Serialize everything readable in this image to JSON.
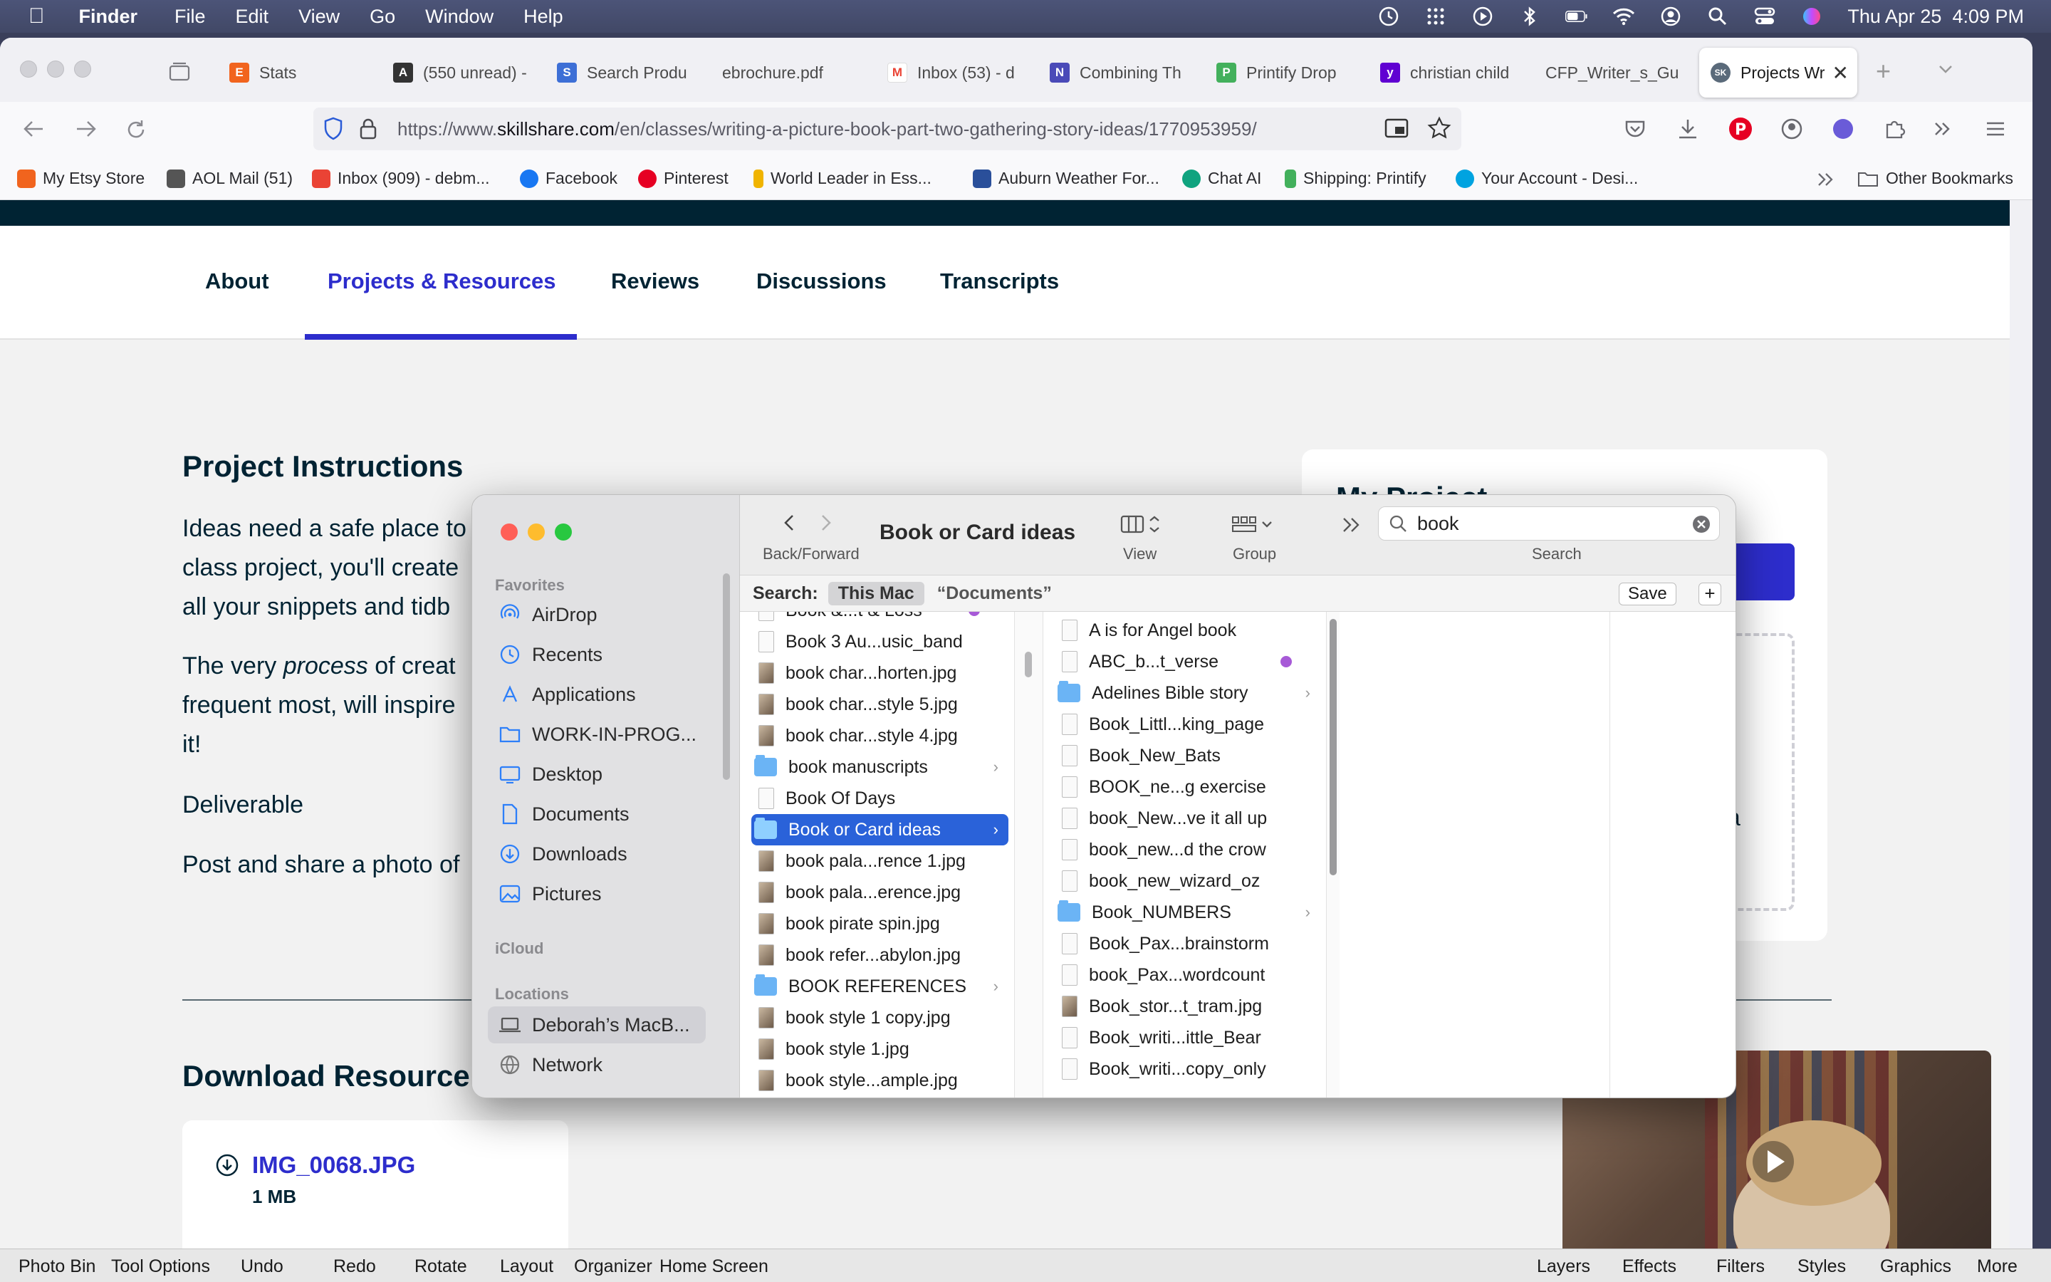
{
  "menubar": {
    "app": "Finder",
    "items": [
      "File",
      "Edit",
      "View",
      "Go",
      "Window",
      "Help"
    ],
    "datetime": "Thu Apr 25  4:09 PM"
  },
  "browser": {
    "tabs": [
      {
        "label": "Stats",
        "icon": "etsy-icon",
        "color": "#f1641e"
      },
      {
        "label": "(550 unread) -",
        "icon": "aol-icon",
        "color": "#333333"
      },
      {
        "label": "Search Produ",
        "icon": "search-product-icon",
        "color": "#3d6fd6"
      },
      {
        "label": "ebrochure.pdf",
        "icon": "",
        "color": ""
      },
      {
        "label": "Inbox (53) - d",
        "icon": "gmail-icon",
        "color": "#ea4335"
      },
      {
        "label": "Combining Th",
        "icon": "notion-icon",
        "color": "#4a4ab8"
      },
      {
        "label": "Printify Drop",
        "icon": "printify-icon",
        "color": "#43b05c"
      },
      {
        "label": "christian child",
        "icon": "yahoo-icon",
        "color": "#6001d2"
      },
      {
        "label": "CFP_Writer_s_Gu",
        "icon": "",
        "color": ""
      },
      {
        "label": "Projects Wr",
        "icon": "skillshare-icon",
        "color": "#5a6a7a"
      }
    ],
    "url_prefix": "https://www.",
    "url_domain": "skillshare.com",
    "url_rest": "/en/classes/writing-a-picture-book-part-two-gathering-story-ideas/1770953959/",
    "bookmarks": [
      {
        "label": "My Etsy Store",
        "color": "#f1641e"
      },
      {
        "label": "AOL Mail (51)",
        "color": "#555555"
      },
      {
        "label": "Inbox (909) - debm...",
        "color": "#ea4335"
      },
      {
        "label": "Facebook",
        "color": "#1877f2"
      },
      {
        "label": "Pinterest",
        "color": "#e60023"
      },
      {
        "label": "World Leader in Ess...",
        "color": "#f0b400"
      },
      {
        "label": "Auburn Weather For...",
        "color": "#2a4f9a"
      },
      {
        "label": "Chat AI",
        "color": "#10a37f"
      },
      {
        "label": "Shipping: Printify",
        "color": "#43b05c"
      },
      {
        "label": "Your Account - Desi...",
        "color": "#00a3e0"
      }
    ],
    "other_bookmarks": "Other Bookmarks"
  },
  "page": {
    "tabs": [
      "About",
      "Projects & Resources",
      "Reviews",
      "Discussions",
      "Transcripts"
    ],
    "active_tab": "Projects & Resources",
    "instructions_title": "Project Instructions",
    "para1": [
      "Ideas need a safe place to rest while life keeps swirling and dancing around them! For your",
      "class project, you'll create",
      "all your snippets and tidb"
    ],
    "para2_a": "The very ",
    "para2_em": "process",
    "para2_b": " of creat",
    "para2_line2": "frequent most, will inspire",
    "para2_line3": "it!",
    "deliverable": "Deliverable",
    "post_share": "Post and share a photo of",
    "my_project": "My Project",
    "my_project_fragment": "t a",
    "download_title": "Download Resource",
    "resource_name": "IMG_0068.JPG",
    "resource_size": "1 MB"
  },
  "finder": {
    "title": "Book or Card ideas",
    "back_forward_label": "Back/Forward",
    "view_label": "View",
    "group_label": "Group",
    "search_label": "Search",
    "search_value": "book",
    "scope_label": "Search:",
    "scope_this_mac": "This Mac",
    "scope_documents": "“Documents”",
    "save_label": "Save",
    "sidebar_favorites": "Favorites",
    "sidebar_icloud": "iCloud",
    "sidebar_locations": "Locations",
    "favorites": [
      {
        "label": "AirDrop",
        "icon": "airdrop-icon"
      },
      {
        "label": "Recents",
        "icon": "recents-clock-icon"
      },
      {
        "label": "Applications",
        "icon": "applications-icon"
      },
      {
        "label": "WORK-IN-PROG...",
        "icon": "folder-icon"
      },
      {
        "label": "Desktop",
        "icon": "desktop-icon"
      },
      {
        "label": "Documents",
        "icon": "document-icon"
      },
      {
        "label": "Downloads",
        "icon": "download-icon"
      },
      {
        "label": "Pictures",
        "icon": "pictures-icon"
      }
    ],
    "locations": [
      {
        "label": "Deborah’s MacB...",
        "icon": "laptop-icon"
      },
      {
        "label": "Network",
        "icon": "network-globe-icon"
      }
    ],
    "col1": [
      {
        "name": "Book &...t & Loss",
        "kind": "file",
        "tag": true
      },
      {
        "name": "Book 3 Au...usic_band",
        "kind": "file"
      },
      {
        "name": "book char...horten.jpg",
        "kind": "img"
      },
      {
        "name": "book char...style 5.jpg",
        "kind": "img"
      },
      {
        "name": "book char...style 4.jpg",
        "kind": "img"
      },
      {
        "name": "book manuscripts",
        "kind": "folder"
      },
      {
        "name": "Book Of Days",
        "kind": "file"
      },
      {
        "name": "Book or Card ideas",
        "kind": "folder",
        "selected": true
      },
      {
        "name": "book pala...rence 1.jpg",
        "kind": "img"
      },
      {
        "name": "book pala...erence.jpg",
        "kind": "img"
      },
      {
        "name": "book pirate spin.jpg",
        "kind": "img"
      },
      {
        "name": "book refer...abylon.jpg",
        "kind": "img"
      },
      {
        "name": "BOOK REFERENCES",
        "kind": "folder"
      },
      {
        "name": "book style 1 copy.jpg",
        "kind": "img"
      },
      {
        "name": "book style 1.jpg",
        "kind": "img"
      },
      {
        "name": "book style...ample.jpg",
        "kind": "img"
      }
    ],
    "col2": [
      {
        "name": "A is for Angel book",
        "kind": "file"
      },
      {
        "name": "ABC_b...t_verse",
        "kind": "file",
        "tag": true
      },
      {
        "name": "Adelines Bible story",
        "kind": "folder"
      },
      {
        "name": "Book_Littl...king_page",
        "kind": "file"
      },
      {
        "name": "Book_New_Bats",
        "kind": "file"
      },
      {
        "name": "BOOK_ne...g exercise",
        "kind": "file"
      },
      {
        "name": "book_New...ve it all up",
        "kind": "file"
      },
      {
        "name": "book_new...d the crow",
        "kind": "file"
      },
      {
        "name": "book_new_wizard_oz",
        "kind": "file"
      },
      {
        "name": "Book_NUMBERS",
        "kind": "folder"
      },
      {
        "name": "Book_Pax...brainstorm",
        "kind": "file"
      },
      {
        "name": "book_Pax...wordcount",
        "kind": "file"
      },
      {
        "name": "Book_stor...t_tram.jpg",
        "kind": "img"
      },
      {
        "name": "Book_writi...ittle_Bear",
        "kind": "file"
      },
      {
        "name": "Book_writi...copy_only",
        "kind": "file"
      }
    ]
  },
  "bottombar": {
    "left": [
      "Photo Bin",
      "Tool Options",
      "Undo",
      "Redo",
      "Rotate",
      "Layout",
      "Organizer",
      "Home Screen"
    ],
    "right": [
      "Layers",
      "Effects",
      "Filters",
      "Styles",
      "Graphics",
      "More"
    ]
  },
  "colors": {
    "accent": "#2d2dcc",
    "dark_band": "#002333",
    "finder_selection": "#2a62d9",
    "tag_purple": "#a75ad7"
  }
}
